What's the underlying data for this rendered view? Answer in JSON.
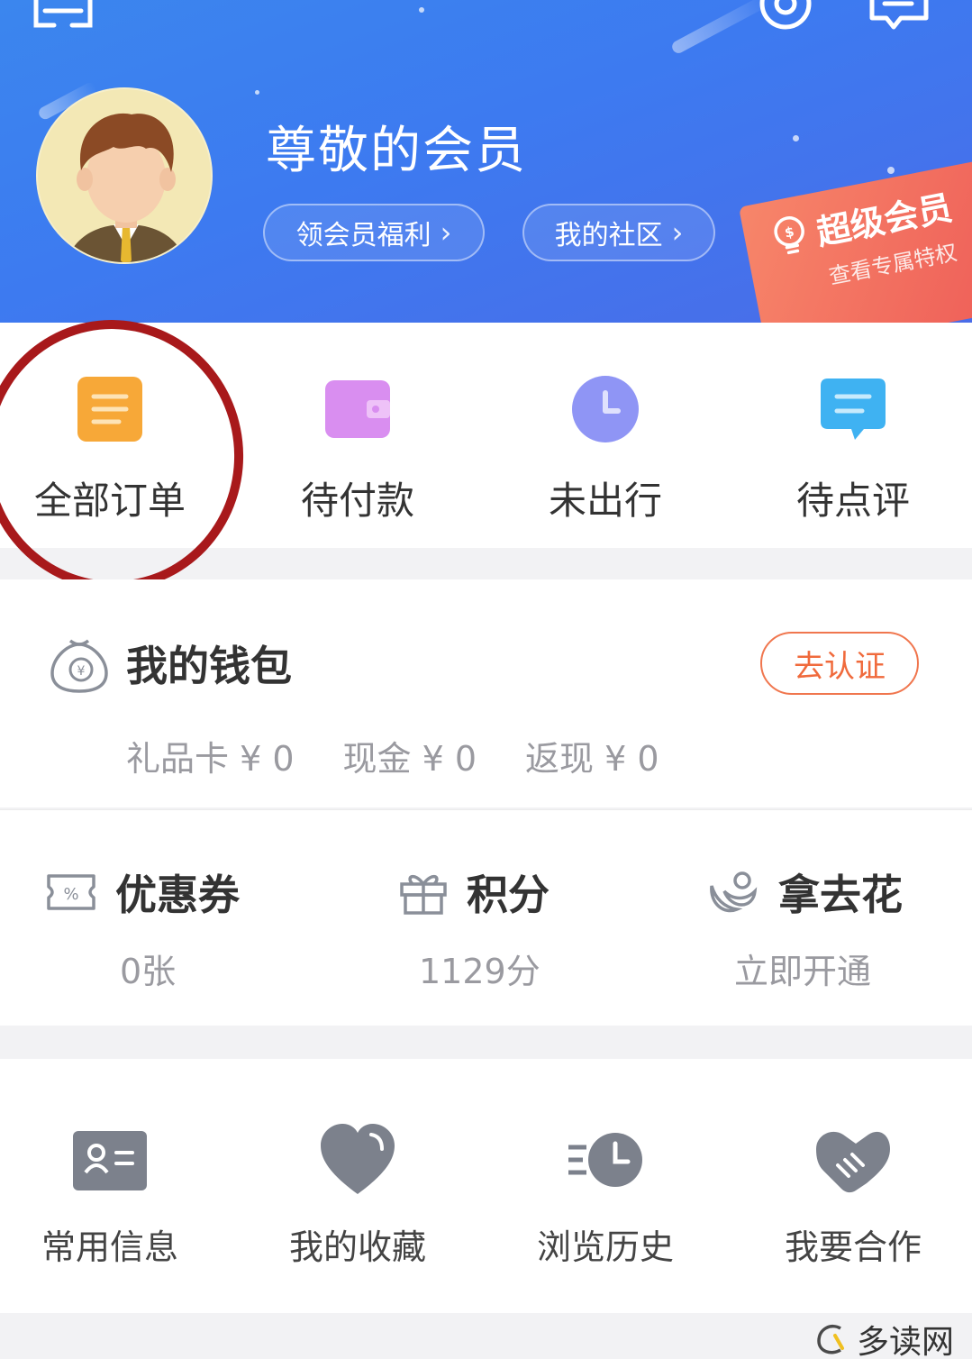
{
  "header": {
    "member_title": "尊敬的会员",
    "benefits_pill": "领会员福利",
    "community_pill": "我的社区",
    "super_member": {
      "title": "超级会员",
      "subtitle": "查看专属特权"
    },
    "icons": [
      "scan-icon",
      "settings-icon",
      "message-icon"
    ]
  },
  "orders": {
    "items": [
      {
        "label": "全部订单",
        "icon": "order-list-icon",
        "color": "#f7a838"
      },
      {
        "label": "待付款",
        "icon": "wallet-icon",
        "color": "#d98ef0"
      },
      {
        "label": "未出行",
        "icon": "clock-icon",
        "color": "#8f95f5"
      },
      {
        "label": "待点评",
        "icon": "comment-icon",
        "color": "#3fb2f2"
      }
    ]
  },
  "wallet": {
    "title": "我的钱包",
    "verify_button": "去认证",
    "balances": [
      {
        "label": "礼品卡 ¥ 0"
      },
      {
        "label": "现金 ¥ 0"
      },
      {
        "label": "返现 ¥ 0"
      }
    ]
  },
  "stats": {
    "items": [
      {
        "label": "优惠券",
        "value": "0张",
        "icon": "coupon-icon"
      },
      {
        "label": "积分",
        "value": "1129分",
        "icon": "gift-icon"
      },
      {
        "label": "拿去花",
        "value": "立即开通",
        "icon": "flower-icon"
      }
    ]
  },
  "tools": {
    "items": [
      {
        "label": "常用信息",
        "icon": "id-card-icon"
      },
      {
        "label": "我的收藏",
        "icon": "heart-icon"
      },
      {
        "label": "浏览历史",
        "icon": "history-icon"
      },
      {
        "label": "我要合作",
        "icon": "handshake-icon"
      }
    ]
  },
  "watermark": "多读网",
  "colors": {
    "header_blue": "#3d7af0",
    "accent_orange": "#f06a3c",
    "annotation_red": "#a8191b",
    "icon_gray": "#7c818c"
  }
}
